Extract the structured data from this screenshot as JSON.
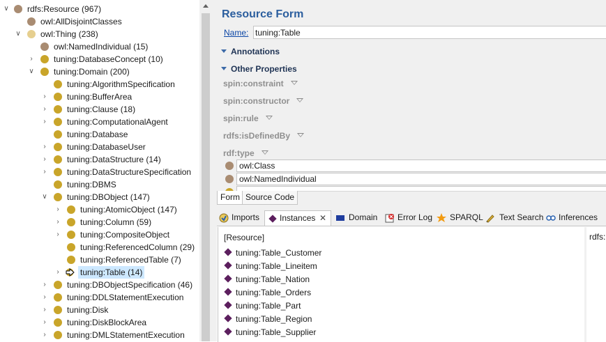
{
  "tree": {
    "items": [
      {
        "label": "rdfs:Resource",
        "count": "(967)"
      },
      {
        "label": "owl:AllDisjointClasses",
        "count": ""
      },
      {
        "label": "owl:Thing",
        "count": "(238)"
      },
      {
        "label": "owl:NamedIndividual",
        "count": "(15)"
      },
      {
        "label": "tuning:DatabaseConcept",
        "count": "(10)"
      },
      {
        "label": "tuning:Domain",
        "count": "(200)"
      },
      {
        "label": "tuning:AlgorithmSpecification",
        "count": ""
      },
      {
        "label": "tuning:BufferArea",
        "count": ""
      },
      {
        "label": "tuning:Clause",
        "count": "(18)"
      },
      {
        "label": "tuning:ComputationalAgent",
        "count": ""
      },
      {
        "label": "tuning:Database",
        "count": ""
      },
      {
        "label": "tuning:DatabaseUser",
        "count": ""
      },
      {
        "label": "tuning:DataStructure",
        "count": "(14)"
      },
      {
        "label": "tuning:DataStructureSpecification",
        "count": ""
      },
      {
        "label": "tuning:DBMS",
        "count": ""
      },
      {
        "label": "tuning:DBObject",
        "count": "(147)"
      },
      {
        "label": "tuning:AtomicObject",
        "count": "(147)"
      },
      {
        "label": "tuning:Column",
        "count": "(59)"
      },
      {
        "label": "tuning:CompositeObject",
        "count": ""
      },
      {
        "label": "tuning:ReferencedColumn",
        "count": "(29)"
      },
      {
        "label": "tuning:ReferencedTable",
        "count": "(7)"
      },
      {
        "label": "tuning:Table",
        "count": "(14)"
      },
      {
        "label": "tuning:DBObjectSpecification",
        "count": "(46)"
      },
      {
        "label": "tuning:DDLStatementExecution",
        "count": ""
      },
      {
        "label": "tuning:Disk",
        "count": ""
      },
      {
        "label": "tuning:DiskBlockArea",
        "count": ""
      },
      {
        "label": "tuning:DMLStatementExecution",
        "count": ""
      }
    ]
  },
  "form": {
    "title": "Resource Form",
    "name_label": "Name:",
    "name_value": "tuning:Table",
    "sections": {
      "annotations": "Annotations",
      "other": "Other Properties"
    },
    "properties": [
      "spin:constraint",
      "spin:constructor",
      "spin:rule",
      "rdfs:isDefinedBy",
      "rdf:type"
    ],
    "types": [
      "owl:Class",
      "owl:NamedIndividual"
    ],
    "tabs": {
      "form": "Form",
      "source": "Source Code"
    }
  },
  "views": {
    "tabs": [
      "Imports",
      "Instances",
      "Domain",
      "Error Log",
      "SPARQL",
      "Text Search",
      "Inferences"
    ],
    "close_glyph": "✕"
  },
  "instances": {
    "header": "[Resource]",
    "side_header": "rdfs:",
    "items": [
      "tuning:Table_Customer",
      "tuning:Table_Lineitem",
      "tuning:Table_Nation",
      "tuning:Table_Orders",
      "tuning:Table_Part",
      "tuning:Table_Region",
      "tuning:Table_Supplier"
    ]
  },
  "colors": {
    "accent": "#2b5e9e",
    "class_dot": "#c9a52a",
    "resource_dot": "#a98c72",
    "thing_dot": "#e6cf8f",
    "instance_diamond": "#5c1f5e",
    "selection": "#cde8ff"
  }
}
